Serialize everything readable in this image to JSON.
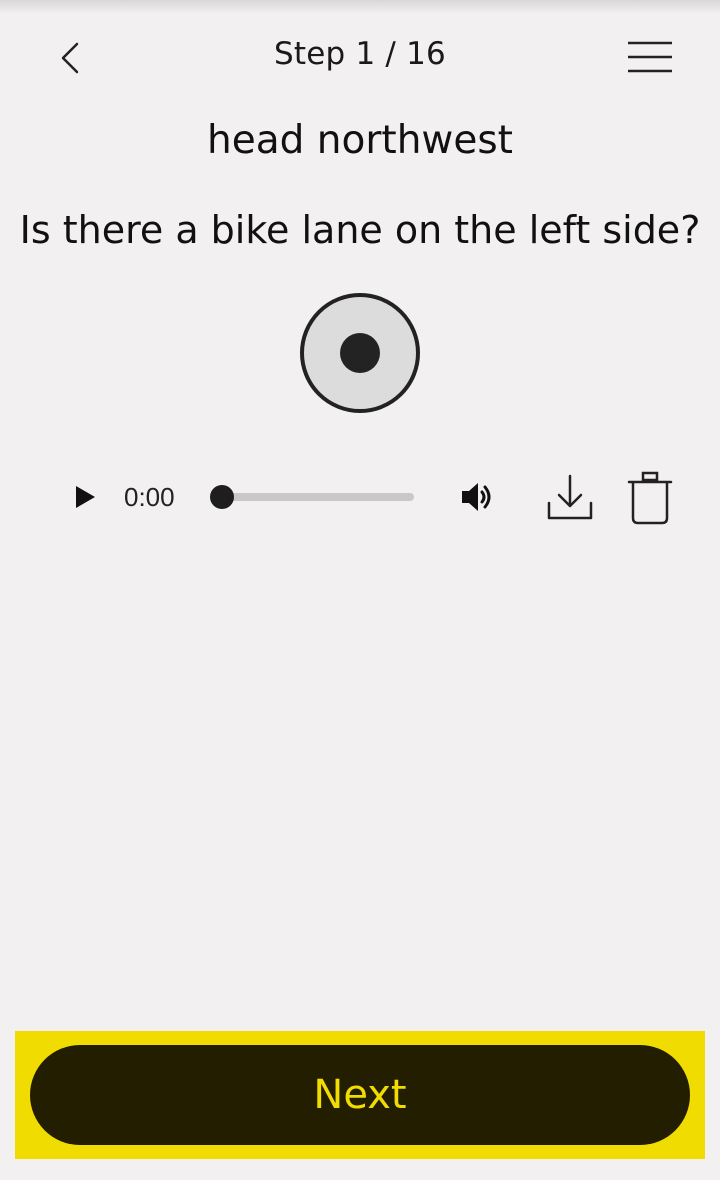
{
  "header": {
    "title": "Step 1 / 16",
    "back_icon": "chevron-left-icon",
    "menu_icon": "hamburger-menu-icon"
  },
  "prompt": {
    "direction": "head northwest",
    "question": "Is there a bike lane on the left side?"
  },
  "recorder": {
    "record_icon": "record-icon"
  },
  "audio_player": {
    "current_time": "0:00",
    "progress": 0,
    "play_icon": "play-icon",
    "volume_icon": "volume-icon",
    "download_icon": "download-icon",
    "delete_icon": "trash-icon"
  },
  "footer": {
    "next_label": "Next"
  },
  "colors": {
    "background": "#f2f0f1",
    "accent_yellow": "#f0dc00",
    "button_dark": "#241e00",
    "record_fill": "#dcdcdc"
  }
}
